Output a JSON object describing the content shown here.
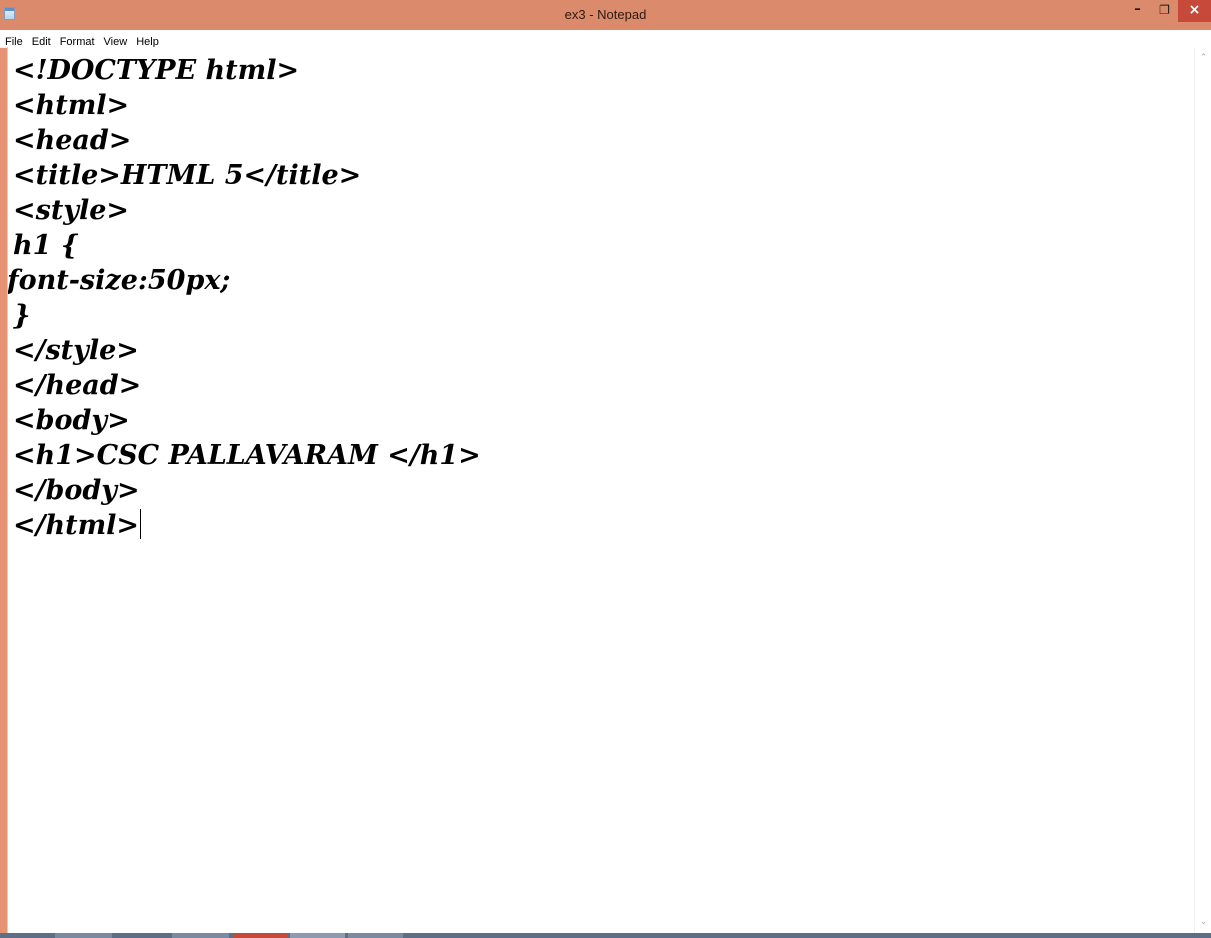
{
  "window": {
    "title": "ex3 - Notepad",
    "minimize_glyph": "–",
    "maximize_glyph": "❐",
    "close_glyph": "×"
  },
  "menu": [
    "File",
    "Edit",
    "Format",
    "View",
    "Help"
  ],
  "editor": {
    "lines": [
      "<!DOCTYPE html>",
      "<html>",
      "<head>",
      "<title>HTML 5</title>",
      "<style>",
      "h1 {",
      "font-size:50px;",
      "}",
      "</style>",
      "</head>",
      "<body>",
      "<h1>CSC PALLAVARAM </h1>",
      "</body>",
      "</html>"
    ]
  },
  "scrollbar": {
    "up_glyph": "⌃",
    "down_glyph": "⌄"
  },
  "colors": {
    "titlebar": "#db8b6b",
    "close_button": "#c7493a",
    "editor_background": "#ffffff",
    "text": "#000000"
  }
}
